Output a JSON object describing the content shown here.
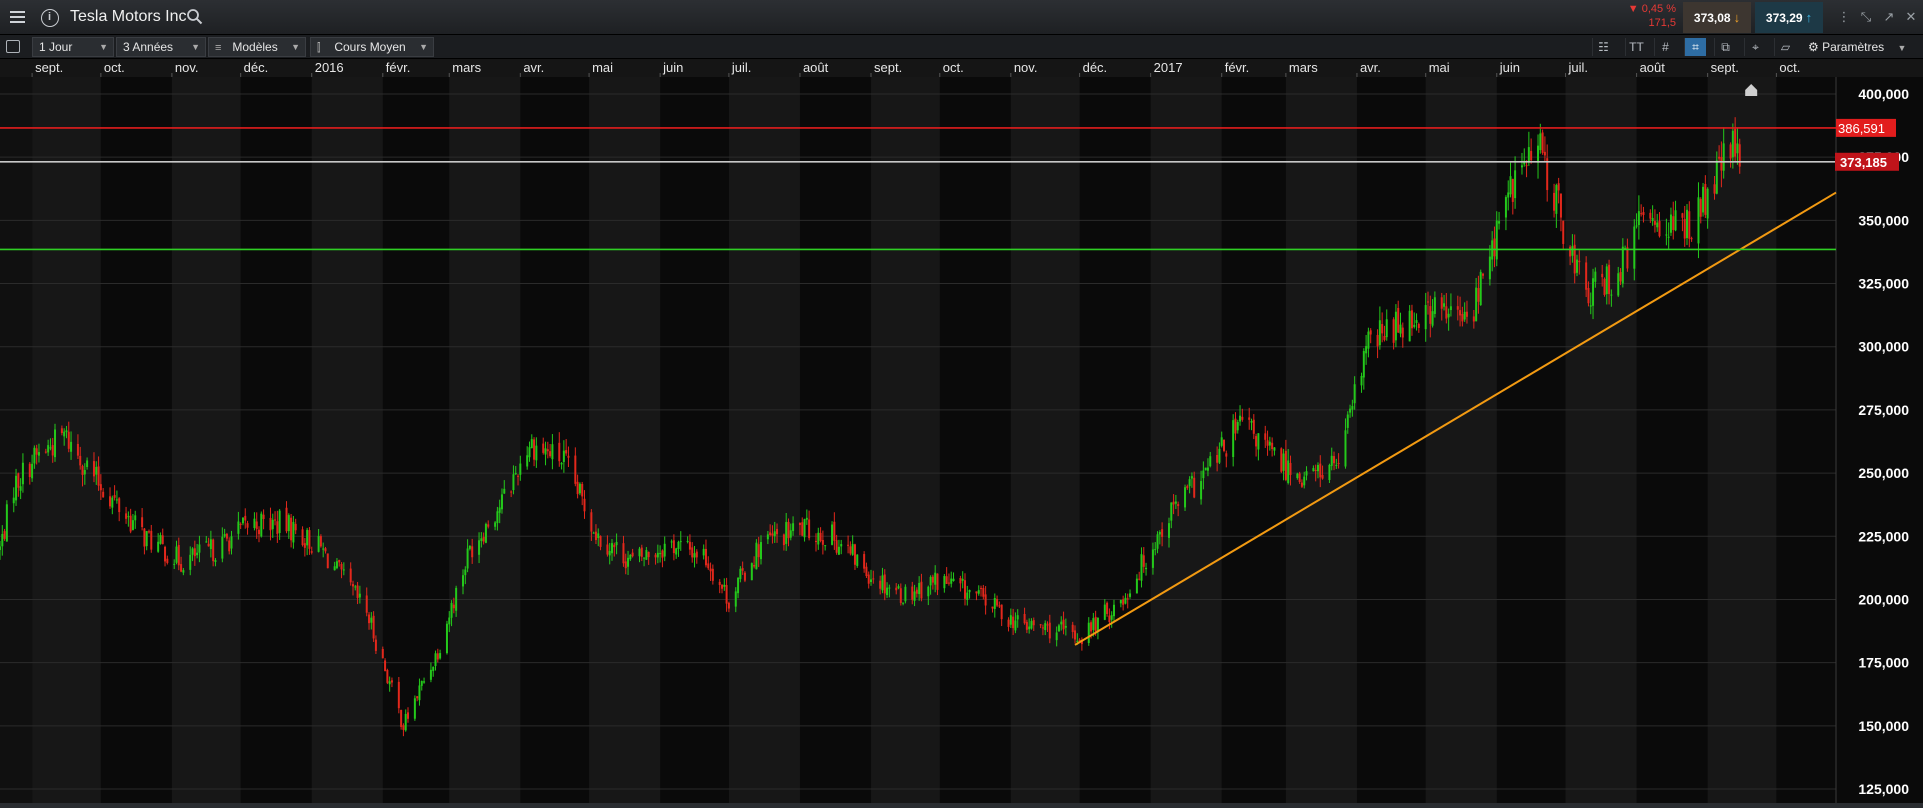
{
  "header": {
    "instrument": "Tesla Motors Inc",
    "change_pct": "▼ 0,45 %",
    "change_abs": "171,5",
    "sell_price": "373,08",
    "buy_price": "373,29"
  },
  "toolbar": {
    "period": "1 Jour",
    "range": "3 Années",
    "models": "Modèles",
    "indicator": "Cours Moyen",
    "settings": "Paramètres"
  },
  "colors": {
    "up": "#24c91b",
    "down": "#e3281c",
    "resistance": "#e21d1d",
    "support": "#2fcf24",
    "trendline": "#f29a12",
    "current": "#c8c8c8"
  },
  "chart_data": {
    "type": "candlestick",
    "title": "Tesla Motors Inc",
    "ylim": [
      125000,
      400000
    ],
    "y_ticks": [
      "400,000",
      "375,000",
      "350,000",
      "325,000",
      "300,000",
      "275,000",
      "250,000",
      "225,000",
      "200,000",
      "175,000",
      "150,000",
      "125,000"
    ],
    "y_tick_values": [
      400000,
      375000,
      350000,
      325000,
      300000,
      275000,
      250000,
      225000,
      200000,
      175000,
      150000,
      125000
    ],
    "x_ticks": [
      "sept.",
      "oct.",
      "nov.",
      "déc.",
      "2016",
      "févr.",
      "mars",
      "avr.",
      "mai",
      "juin",
      "juil.",
      "août",
      "sept.",
      "oct.",
      "nov.",
      "déc.",
      "2017",
      "févr.",
      "mars",
      "avr.",
      "mai",
      "juin",
      "juil.",
      "août",
      "sept.",
      "oct."
    ],
    "x_tick_dates": [
      "2015-09-01",
      "2015-10-01",
      "2015-11-01",
      "2015-12-01",
      "2016-01-01",
      "2016-02-01",
      "2016-03-01",
      "2016-04-01",
      "2016-05-01",
      "2016-06-01",
      "2016-07-01",
      "2016-08-01",
      "2016-09-01",
      "2016-10-01",
      "2016-11-01",
      "2016-12-01",
      "2017-01-01",
      "2017-02-01",
      "2017-03-01",
      "2017-04-01",
      "2017-05-01",
      "2017-06-01",
      "2017-07-01",
      "2017-08-01",
      "2017-09-01",
      "2017-10-01"
    ],
    "x_range": [
      "2015-08-18",
      "2017-10-27"
    ],
    "series_anchor_dates": [
      "2015-08-18",
      "2015-08-24",
      "2015-09-01",
      "2015-09-15",
      "2015-10-01",
      "2015-10-20",
      "2015-11-05",
      "2015-11-20",
      "2015-12-05",
      "2015-12-20",
      "2016-01-05",
      "2016-01-25",
      "2016-02-10",
      "2016-02-25",
      "2016-03-10",
      "2016-03-25",
      "2016-04-05",
      "2016-04-20",
      "2016-05-05",
      "2016-05-20",
      "2016-06-05",
      "2016-06-20",
      "2016-07-01",
      "2016-07-15",
      "2016-08-01",
      "2016-08-15",
      "2016-09-01",
      "2016-09-15",
      "2016-10-01",
      "2016-10-20",
      "2016-11-05",
      "2016-11-20",
      "2016-12-01",
      "2016-12-20",
      "2017-01-10",
      "2017-01-25",
      "2017-02-10",
      "2017-02-25",
      "2017-03-10",
      "2017-03-25",
      "2017-04-05",
      "2017-04-20",
      "2017-05-05",
      "2017-05-20",
      "2017-06-01",
      "2017-06-10",
      "2017-06-20",
      "2017-07-01",
      "2017-07-10",
      "2017-07-25",
      "2017-08-05",
      "2017-08-20",
      "2017-09-01",
      "2017-09-10",
      "2017-09-15"
    ],
    "series_anchor_closes": [
      220000,
      245000,
      255000,
      265000,
      245000,
      225000,
      215000,
      220000,
      230000,
      230000,
      220000,
      195000,
      150000,
      180000,
      220000,
      240000,
      262000,
      255000,
      225000,
      215000,
      222000,
      218000,
      200000,
      222000,
      228000,
      225000,
      210000,
      202000,
      208000,
      200000,
      190000,
      188000,
      185000,
      200000,
      235000,
      250000,
      270000,
      255000,
      248000,
      255000,
      300000,
      310000,
      315000,
      310000,
      345000,
      370000,
      378000,
      345000,
      320000,
      330000,
      355000,
      345000,
      358000,
      380000,
      373000
    ],
    "candle_count": 520,
    "hlines": [
      {
        "label": "386,591",
        "value": 386591,
        "color": "#e21d1d"
      },
      {
        "label": "373,185",
        "value": 373185,
        "color": "#c8c8c8"
      },
      {
        "value": 338500,
        "color": "#2fcf24"
      }
    ],
    "trendline": {
      "start": [
        "2016-11-29",
        182000
      ],
      "end": [
        "2017-10-27",
        361000
      ],
      "color": "#f29a12"
    }
  }
}
